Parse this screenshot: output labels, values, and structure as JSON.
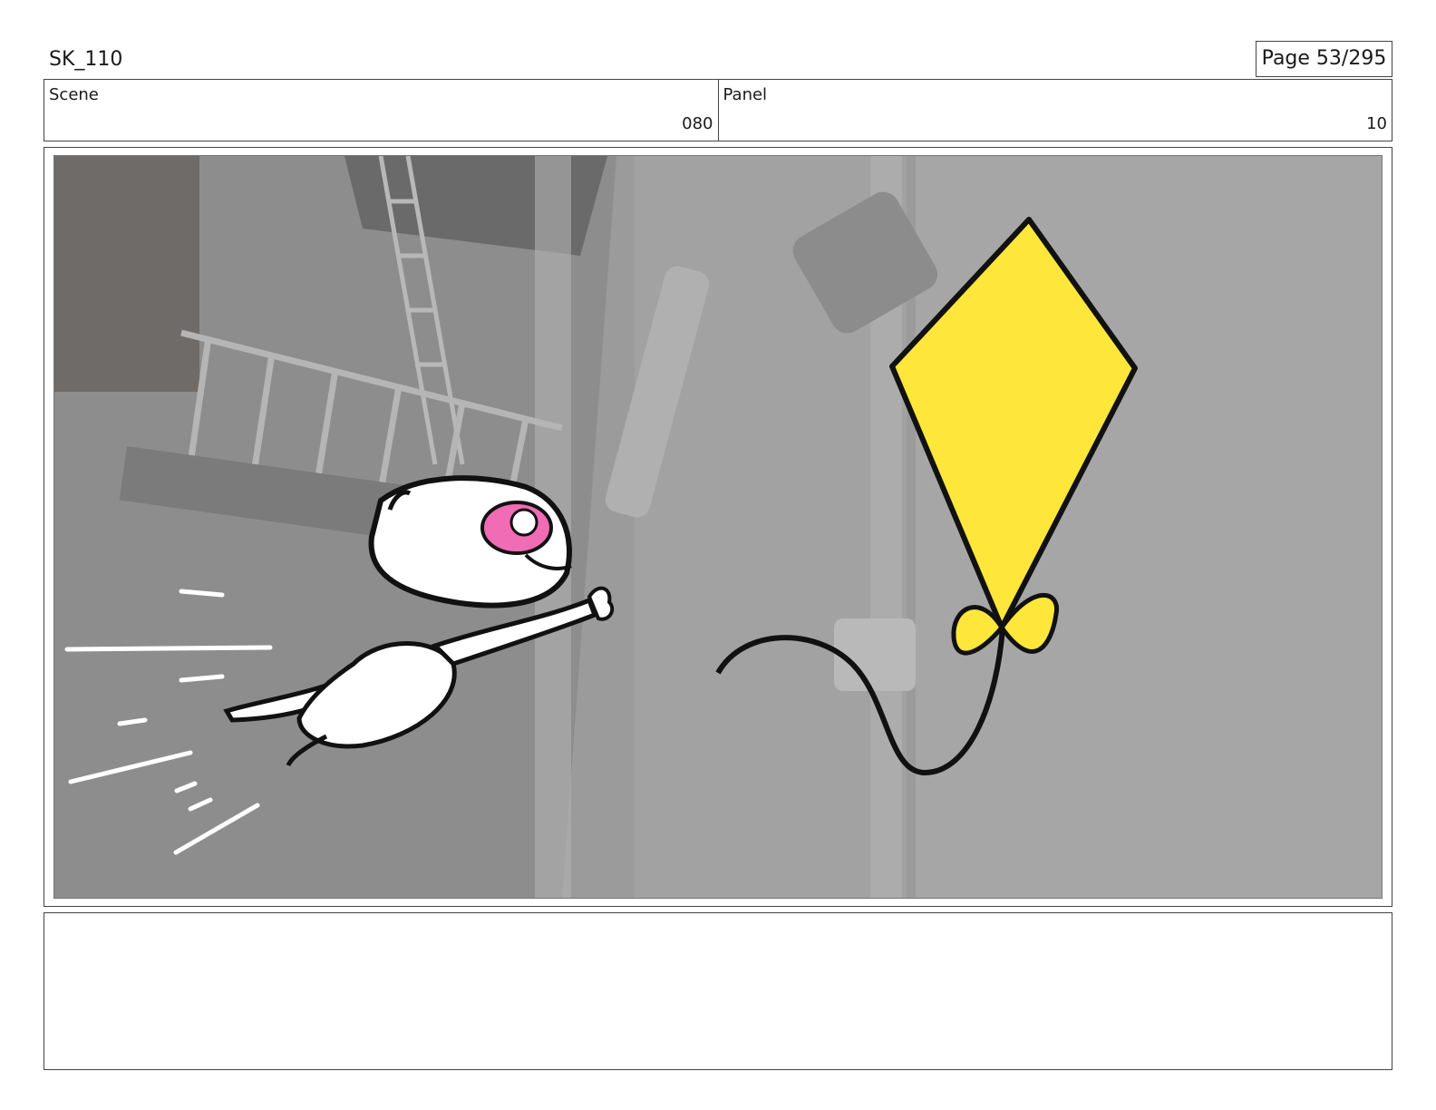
{
  "header": {
    "title": "SK_110",
    "page_label": "Page 53/295"
  },
  "info": {
    "scene_label": "Scene",
    "scene_value": "080",
    "panel_label": "Panel",
    "panel_value": "10"
  },
  "panel_image": {
    "subject": "white cat leaping toward a yellow kite",
    "colors": {
      "background": "#9a9a9a",
      "kite": "#ffe63b",
      "cat_body": "#ffffff",
      "cat_eye": "#f06cb4",
      "outline": "#111111"
    }
  },
  "notes": {
    "text": ""
  }
}
